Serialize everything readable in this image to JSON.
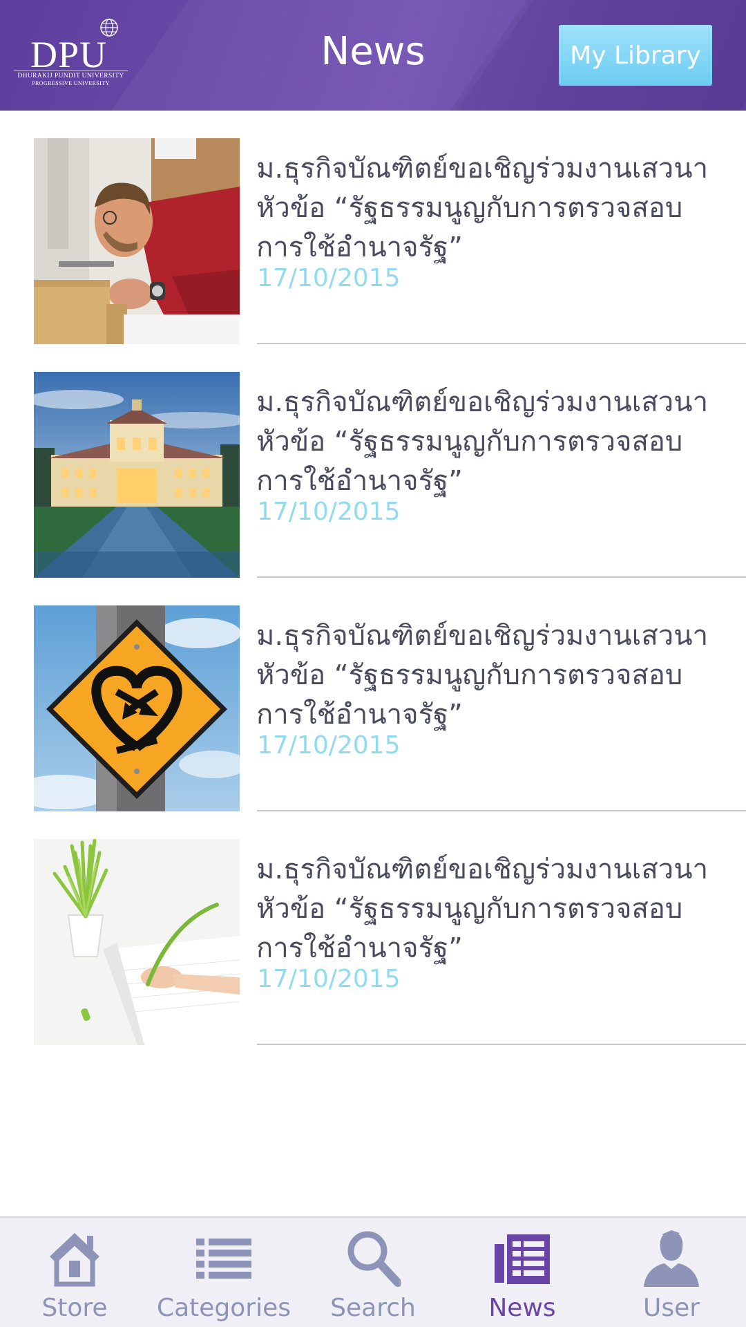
{
  "header": {
    "logo_text": "DPU",
    "logo_sub": "DHURAKIJ PUNDIT UNIVERSITY",
    "logo_sub2": "PROGRESSIVE UNIVERSITY",
    "title": "News",
    "library_button": "My Library"
  },
  "news": [
    {
      "title": "ม.ธุรกิจบัณฑิตย์ขอเชิญร่วมงานเสวนา หัวข้อ “รัฐธรรมนูญกับการตรวจสอบการใช้อำนาจรัฐ”",
      "date": "17/10/2015",
      "image": "man-woodworking"
    },
    {
      "title": "ม.ธุรกิจบัณฑิตย์ขอเชิญร่วมงานเสวนา หัวข้อ “รัฐธรรมนูญกับการตรวจสอบการใช้อำนาจรัฐ”",
      "date": "17/10/2015",
      "image": "palace-at-dusk"
    },
    {
      "title": "ม.ธุรกิจบัณฑิตย์ขอเชิญร่วมงานเสวนา หัวข้อ “รัฐธรรมนูญกับการตรวจสอบการใช้อำนาจรัฐ”",
      "date": "17/10/2015",
      "image": "heart-road-sign"
    },
    {
      "title": "ม.ธุรกิจบัณฑิตย์ขอเชิญร่วมงานเสวนา หัวข้อ “รัฐธรรมนูญกับการตรวจสอบการใช้อำนาจรัฐ”",
      "date": "17/10/2015",
      "image": "grass-pen-notebook"
    }
  ],
  "tabs": [
    {
      "label": "Store",
      "icon": "house-icon",
      "active": false
    },
    {
      "label": "Categories",
      "icon": "list-icon",
      "active": false
    },
    {
      "label": "Search",
      "icon": "magnifier-icon",
      "active": false
    },
    {
      "label": "News",
      "icon": "newspaper-icon",
      "active": true
    },
    {
      "label": "User",
      "icon": "person-icon",
      "active": false
    }
  ],
  "colors": {
    "header": "#6a4aa8",
    "accent_button": "#7fd4f5",
    "date": "#92dbef",
    "tab_inactive": "#8e94b8",
    "tab_active": "#6a45a8"
  }
}
